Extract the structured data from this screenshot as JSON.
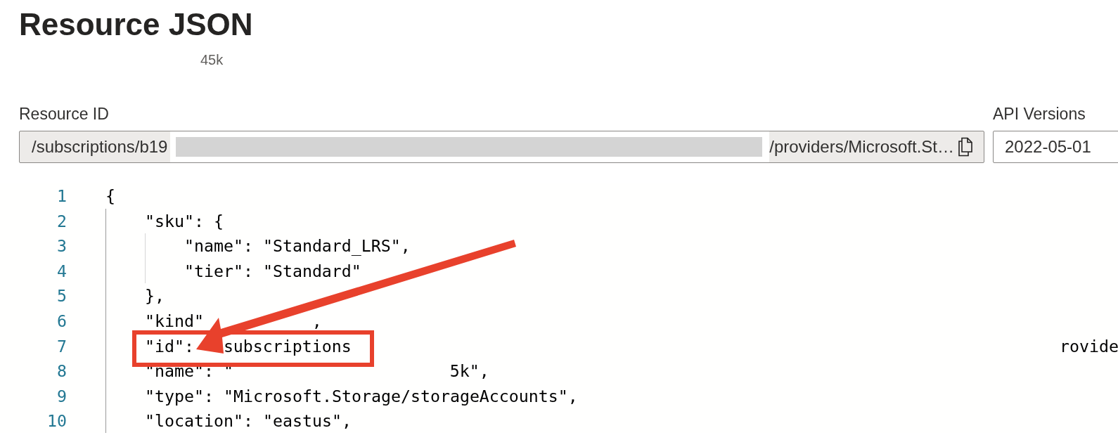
{
  "page": {
    "title": "Resource JSON",
    "subtitle": "45k"
  },
  "resource_id": {
    "label": "Resource ID",
    "value_start": "/subscriptions/b19",
    "redacted": true,
    "value_end": "/providers/Microsoft.St…"
  },
  "api_versions": {
    "label": "API Versions",
    "value": "2022-05-01"
  },
  "code": [
    {
      "number": "1",
      "text": "{",
      "children": [
        {
          "number": "2",
          "text": "\"sku\": {",
          "children": [
            {
              "number": "3",
              "text": "\"name\": \"Standard_LRS\","
            },
            {
              "number": "4",
              "text": "\"tier\": \"Standard\""
            }
          ]
        },
        {
          "number": "5",
          "text": "},"
        },
        {
          "number": "6",
          "text": "\"kind\"",
          "tails": [
            ","
          ]
        },
        {
          "number": "7",
          "text": "\"id\":",
          "tails": [
            "subscriptions",
            "rovide"
          ]
        },
        {
          "number": "8",
          "text": "\"name\": \"",
          "tails": [
            "5k\","
          ]
        },
        {
          "number": "9",
          "text": "\"type\": \"Microsoft.Storage/storageAccounts\","
        },
        {
          "number": "10",
          "text": "\"location\": \"eastus\","
        }
      ]
    }
  ]
}
